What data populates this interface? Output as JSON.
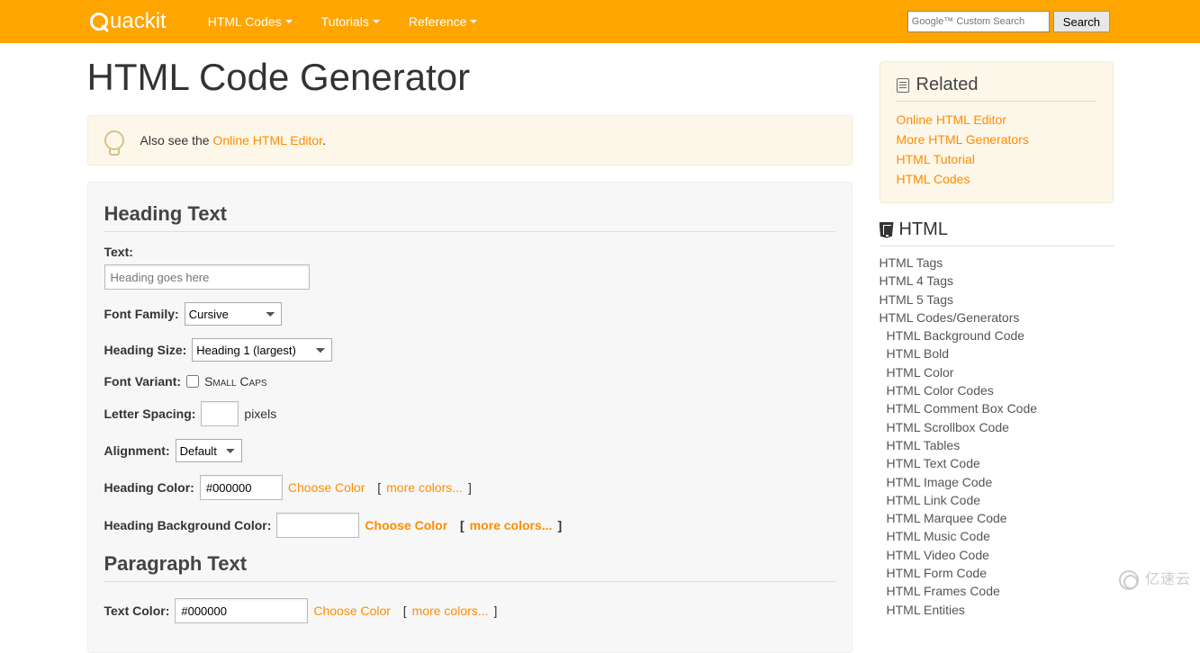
{
  "nav": {
    "logo_text": "uackit",
    "items": [
      "HTML Codes",
      "Tutorials",
      "Reference"
    ],
    "search_placeholder": "Google™ Custom Search",
    "search_btn": "Search"
  },
  "page": {
    "title": "HTML Code Generator",
    "alert_prefix": "Also see the ",
    "alert_link": "Online HTML Editor",
    "alert_suffix": "."
  },
  "heading_section": {
    "title": "Heading Text",
    "text_label": "Text:",
    "text_placeholder": "Heading goes here",
    "font_family_label": "Font Family:",
    "font_family_value": "Cursive",
    "heading_size_label": "Heading Size:",
    "heading_size_value": "Heading 1 (largest)",
    "font_variant_label": "Font Variant:",
    "font_variant_option": "Small Caps",
    "letter_spacing_label": "Letter Spacing:",
    "letter_spacing_unit": "pixels",
    "alignment_label": "Alignment:",
    "alignment_value": "Default",
    "heading_color_label": "Heading Color:",
    "heading_color_value": "#000000",
    "choose_color": "Choose Color",
    "more_colors": "more colors...",
    "bg_color_label": "Heading Background Color:",
    "bg_color_value": ""
  },
  "paragraph_section": {
    "title": "Paragraph Text",
    "text_color_label": "Text Color:",
    "text_color_value": "#000000",
    "choose_color": "Choose Color",
    "more_colors": "more colors..."
  },
  "related": {
    "title": "Related",
    "links": [
      "Online HTML Editor",
      "More HTML Generators",
      "HTML Tutorial",
      "HTML Codes"
    ]
  },
  "html_nav": {
    "title": "HTML",
    "top": [
      "HTML Tags",
      "HTML 4 Tags",
      "HTML 5 Tags",
      "HTML Codes/Generators"
    ],
    "sub": [
      "HTML Background Code",
      "HTML Bold",
      "HTML Color",
      "HTML Color Codes",
      "HTML Comment Box Code",
      "HTML Scrollbox Code",
      "HTML Tables",
      "HTML Text Code",
      "HTML Image Code",
      "HTML Link Code",
      "HTML Marquee Code",
      "HTML Music Code",
      "HTML Video Code",
      "HTML Form Code",
      "HTML Frames Code",
      "HTML Entities"
    ]
  },
  "watermark": "亿速云"
}
